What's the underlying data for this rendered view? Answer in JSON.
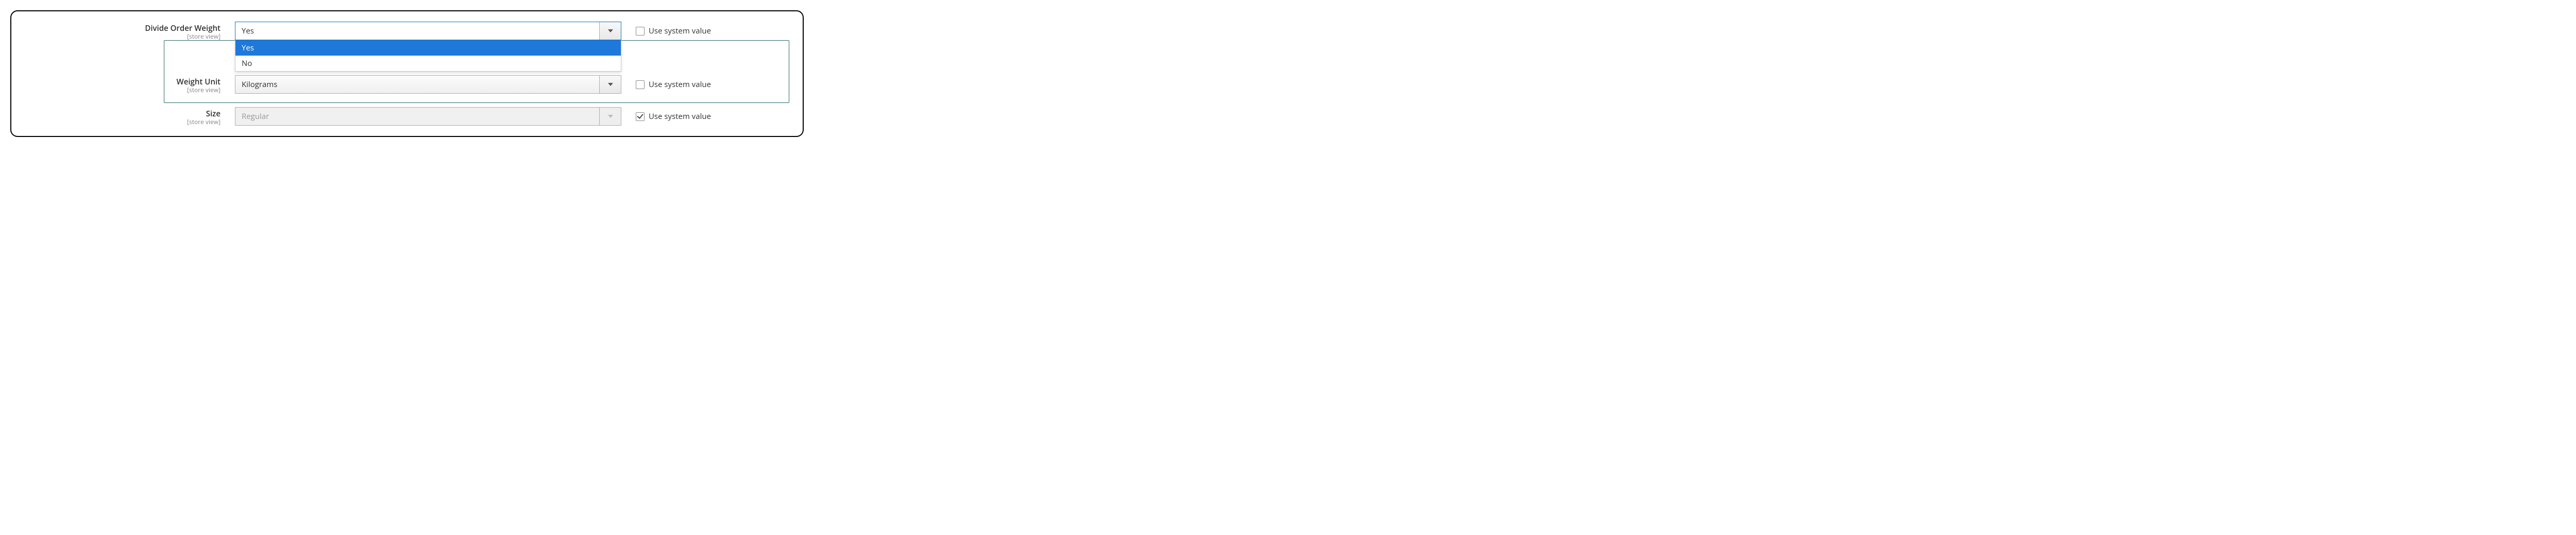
{
  "fields": {
    "divide": {
      "label": "Divide Order Weight",
      "scope": "[store view]",
      "value": "Yes",
      "options": [
        "Yes",
        "No"
      ],
      "use_system_label": "Use system value",
      "use_system_checked": false
    },
    "weight_unit": {
      "label": "Weight Unit",
      "scope": "[store view]",
      "value": "Kilograms",
      "use_system_label": "Use system value",
      "use_system_checked": false
    },
    "size": {
      "label": "Size",
      "scope": "[store view]",
      "value": "Regular",
      "use_system_label": "Use system value",
      "use_system_checked": true
    }
  }
}
